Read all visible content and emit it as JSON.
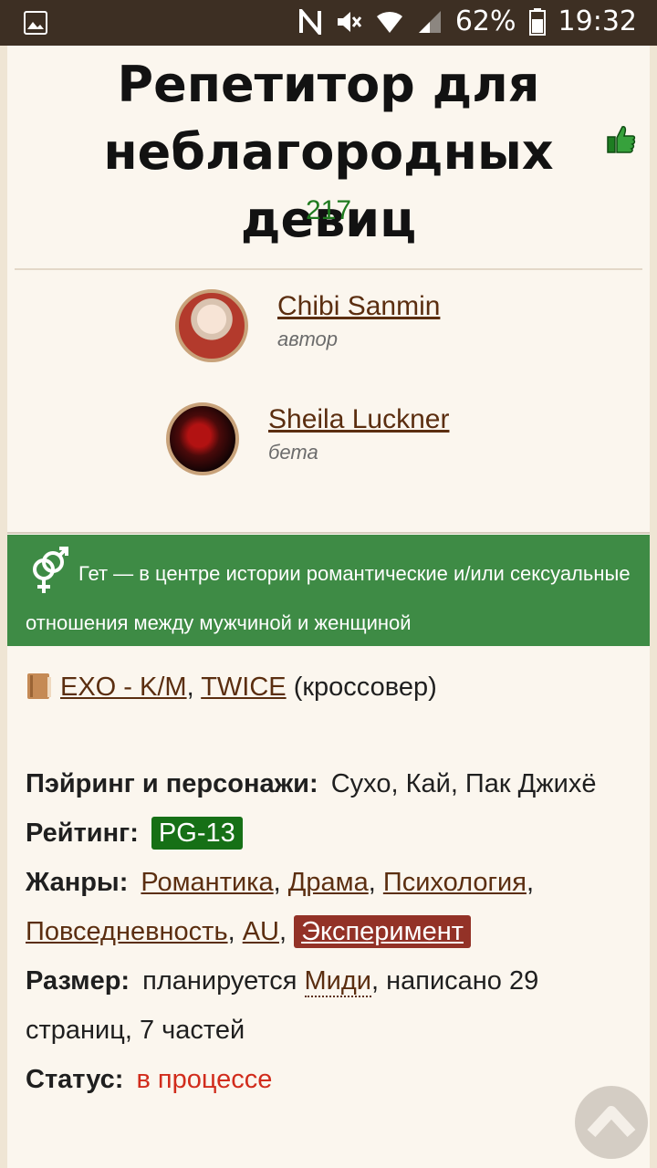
{
  "status_bar": {
    "battery": "62%",
    "time": "19:32",
    "icons": [
      "image-icon",
      "nfc-icon",
      "mute-icon",
      "wifi-icon",
      "signal-icon",
      "battery-icon"
    ]
  },
  "work": {
    "title": "Репетитор для неблагородных девиц",
    "likes": "217"
  },
  "people": [
    {
      "name": "Chibi Sanmin",
      "role": "автор"
    },
    {
      "name": "Sheila Luckner",
      "role": "бета"
    }
  ],
  "direction": {
    "text": "Гет — в центре истории романтические и/или сексуальные отношения между мужчиной и женщиной",
    "color": "#3e8b45"
  },
  "fandom": {
    "links": [
      "EXO - K/M",
      "TWICE"
    ],
    "separator": ",",
    "note": "(кроссовер)"
  },
  "info": {
    "pairing_label": "Пэйринг и персонажи:",
    "pairing_value": "Сухо, Кай, Пак Джихё",
    "rating_label": "Рейтинг:",
    "rating_value": "PG-13",
    "genres_label": "Жанры:",
    "genres": [
      "Романтика",
      "Драма",
      "Психология",
      "Повседневность",
      "AU"
    ],
    "genre_highlight": "Эксперимент",
    "size_label": "Размер:",
    "size_prefix": "планируется",
    "size_link": "Миди",
    "size_suffix": ", написано 29 страниц, 7 частей",
    "status_label": "Статус:",
    "status_value": "в процессе"
  }
}
